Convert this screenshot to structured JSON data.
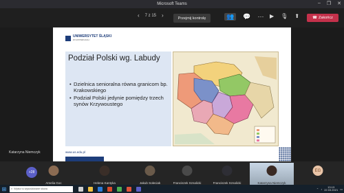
{
  "window": {
    "title": "Microsoft Teams"
  },
  "toolbar": {
    "slide_counter": "7 z 15",
    "take_control": "Przejmij kontrolę",
    "leave": "Zakończ"
  },
  "slide": {
    "logo_line1": "UNIWERSYTET ŚLĄSKI",
    "logo_line2": "W KATOWICACH",
    "title": "Podział Polski wg. Labudy",
    "bullets": [
      "Dzielnica senioralna równa granicom bp. Krakowskiego",
      "Podział Polski jedynie pomiędzy trzech synów Krzywoustego"
    ],
    "url": "www.us.edu.pl"
  },
  "presenter": {
    "name": "Katarzyna Niemczyk"
  },
  "participants": {
    "overflow": "+28",
    "names": [
      "Amelia Goc",
      "Helena Kantyka",
      "Jakub Sołeciak",
      "Franciszek Sznalicki",
      "Katarzyna Niemczyk"
    ],
    "initials": "EG"
  },
  "taskbar": {
    "search_placeholder": "Wpisz tu wyszukiwane słowa",
    "time": "13:13",
    "date": "22.03.2021"
  }
}
